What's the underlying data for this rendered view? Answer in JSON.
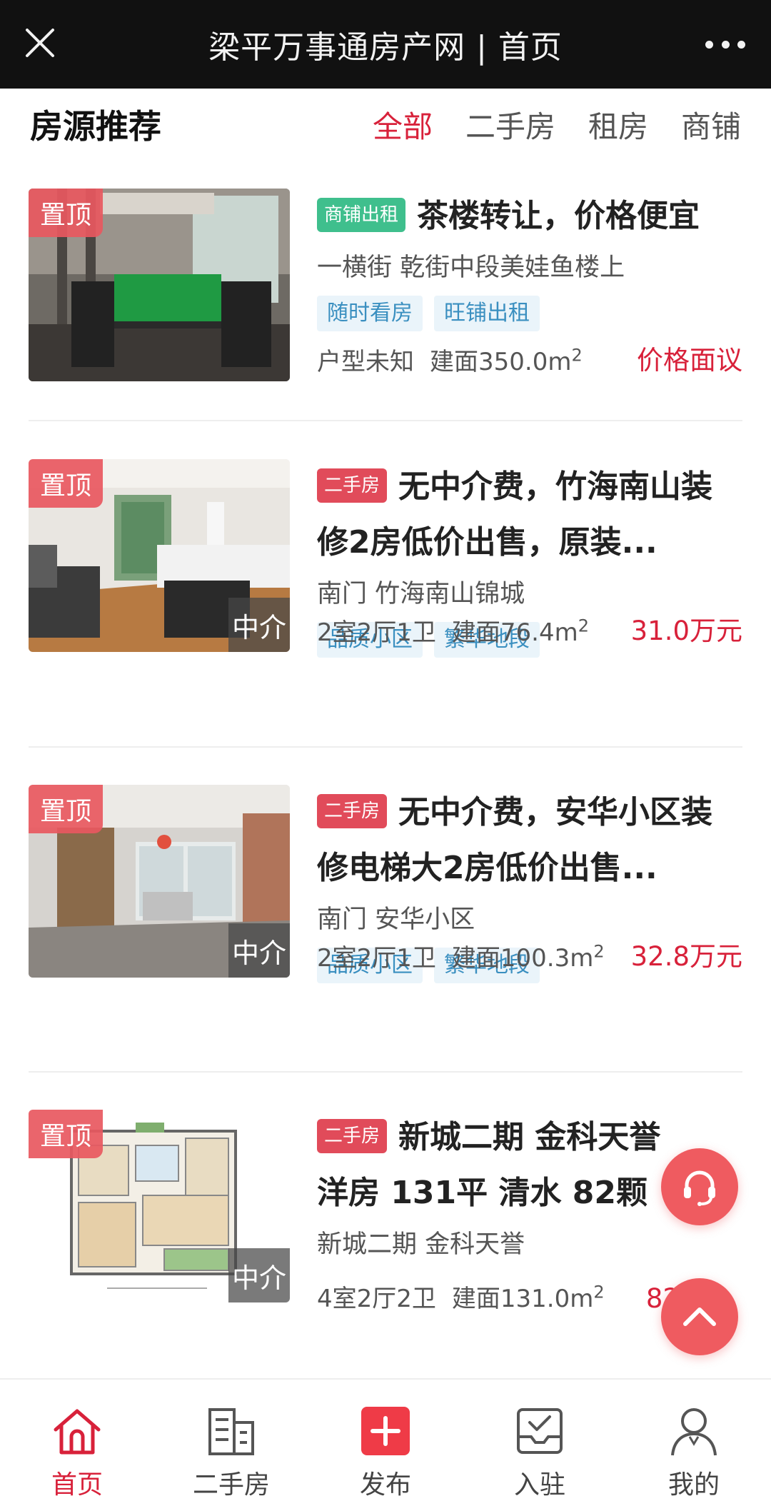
{
  "titlebar": {
    "title": "梁平万事通房产网 | 首页",
    "close_icon": "close-icon",
    "more_icon": "more-dots-icon"
  },
  "section": {
    "title": "房源推荐",
    "filters": [
      {
        "label": "全部",
        "active": true
      },
      {
        "label": "二手房",
        "active": false
      },
      {
        "label": "租房",
        "active": false
      },
      {
        "label": "商铺",
        "active": false
      }
    ]
  },
  "listings": [
    {
      "pin": "置顶",
      "type_tag": "商铺出租",
      "title": "茶楼转让，价格便宜",
      "location": "一横街 乾街中段美娃鱼楼上",
      "tags": [
        "随时看房",
        "旺铺出租"
      ],
      "layout": "户型未知",
      "area_label": "建面350.0m",
      "area_sup": "2",
      "price": "价格面议",
      "agent": ""
    },
    {
      "pin": "置顶",
      "type_tag": "二手房",
      "title": "无中介费，竹海南山装修2房低价出售，原装...",
      "location": "南门 竹海南山锦城",
      "tags": [
        "品质小区",
        "繁华地段"
      ],
      "layout": "2室2厅1卫",
      "area_label": "建面76.4m",
      "area_sup": "2",
      "price": "31.0万元",
      "agent": "中介"
    },
    {
      "pin": "置顶",
      "type_tag": "二手房",
      "title": "无中介费，安华小区装修电梯大2房低价出售...",
      "location": "南门 安华小区",
      "tags": [
        "品质小区",
        "繁华地段"
      ],
      "layout": "2室2厅1卫",
      "area_label": "建面100.3m",
      "area_sup": "2",
      "price": "32.8万元",
      "agent": "中介"
    },
    {
      "pin": "置顶",
      "type_tag": "二手房",
      "title": "新城二期 金科天誉洋房 131平 清水 82颗 ...",
      "location": "新城二期 金科天誉",
      "tags": [],
      "layout": "4室2厅2卫",
      "area_label": "建面131.0m",
      "area_sup": "2",
      "price": "82",
      "agent": "中介"
    }
  ],
  "floating": {
    "service_icon": "headset-icon",
    "top_icon": "chevron-up-icon"
  },
  "bottom_nav": [
    {
      "label": "首页",
      "icon": "home-icon",
      "active": true
    },
    {
      "label": "二手房",
      "icon": "building-icon",
      "active": false
    },
    {
      "label": "发布",
      "icon": "plus-icon",
      "active": false
    },
    {
      "label": "入驻",
      "icon": "inbox-check-icon",
      "active": false
    },
    {
      "label": "我的",
      "icon": "user-icon",
      "active": false
    }
  ],
  "colors": {
    "accent": "#d8213a",
    "fab": "#ef5b60",
    "tag_text": "#3a8fc0",
    "tag_bg": "#eaf4fa",
    "green_tag": "#3fbf8d"
  }
}
